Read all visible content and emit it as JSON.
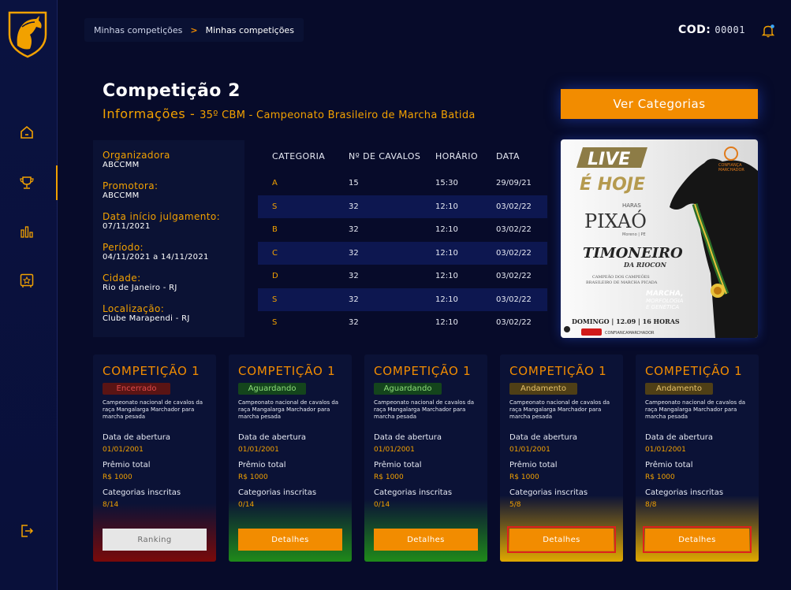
{
  "breadcrumb": {
    "parent": "Minhas competições",
    "separator": ">",
    "current": "Minhas competições"
  },
  "header": {
    "cod_label": "COD:",
    "cod_value": "00001"
  },
  "page": {
    "title": "Competição 2",
    "subtitle_label": "Informações - ",
    "subtitle_detail": "35º CBM - Campeonato Brasileiro de Marcha Batida",
    "categories_button": "Ver Categorias"
  },
  "info": [
    {
      "label": "Organizadora",
      "value": "ABCCMM"
    },
    {
      "label": "Promotora:",
      "value": "ABCCMM"
    },
    {
      "label": "Data início julgamento:",
      "value": " 07/11/2021"
    },
    {
      "label": "Período:",
      "value": "04/11/2021  a  14/11/2021"
    },
    {
      "label": "Cidade:",
      "value": "Rio de Janeiro - RJ"
    },
    {
      "label": "Localização:",
      "value": "Clube Marapendi - RJ"
    }
  ],
  "table": {
    "headers": [
      "CATEGORIA",
      "Nº DE CAVALOS",
      "HORÁRIO",
      "DATA"
    ],
    "rows": [
      [
        "A",
        "15",
        "15:30",
        "29/09/21"
      ],
      [
        "S",
        "32",
        "12:10",
        "03/02/22"
      ],
      [
        "B",
        "32",
        "12:10",
        "03/02/22"
      ],
      [
        "C",
        "32",
        "12:10",
        "03/02/22"
      ],
      [
        "D",
        "32",
        "12:10",
        "03/02/22"
      ],
      [
        "S",
        "32",
        "12:10",
        "03/02/22"
      ],
      [
        "S",
        "32",
        "12:10",
        "03/02/22"
      ]
    ]
  },
  "promo": {
    "live": "LIVE",
    "hoje": "É HOJE",
    "haras": "HARAS",
    "pixao": "PIXAÓ",
    "location": "Moreno | PE",
    "horse_name": "TIMONEIRO",
    "horse_suffix": "DA RIOCON",
    "champion_line1": "CAMPEÃO DOS CAMPEÕES",
    "champion_line2": "BRASILEIRO DE MARCHA PICADA",
    "marcha": "MARCHA,",
    "morfologia": "MORFOLOGIA",
    "genetica": "E GENÉTICA",
    "schedule": "DOMINGO | 12.09 | 16 HORAS",
    "youtube": "CONFIANCAMARCHADOR",
    "brand_line1": "CONFIANÇA",
    "brand_line2": "MARCHADOR"
  },
  "cards": [
    {
      "title": "COMPETIÇÃO 1",
      "status": "Encerrado",
      "desc": "Campeonato nacional de cavalos da raça Mangalarga Marchador para marcha pesada",
      "open_label": "Data de abertura",
      "open_value": "01/01/2001",
      "prize_label": "Prêmio total",
      "prize_value": "R$ 1000",
      "cat_label": "Categorias inscritas",
      "cat_value": "8/14",
      "button": "Ranking"
    },
    {
      "title": "COMPETIÇÃO 1",
      "status": "Aguardando",
      "desc": "Campeonato nacional de cavalos da raça Mangalarga Marchador para marcha pesada",
      "open_label": "Data de abertura",
      "open_value": "01/01/2001",
      "prize_label": "Prêmio total",
      "prize_value": "R$ 1000",
      "cat_label": "Categorias inscritas",
      "cat_value": "0/14",
      "button": "Detalhes"
    },
    {
      "title": "COMPETIÇÃO 1",
      "status": "Aguardando",
      "desc": "Campeonato nacional de cavalos da raça Mangalarga Marchador para marcha pesada",
      "open_label": "Data de abertura",
      "open_value": "01/01/2001",
      "prize_label": "Prêmio total",
      "prize_value": "R$ 1000",
      "cat_label": "Categorias inscritas",
      "cat_value": "0/14",
      "button": "Detalhes"
    },
    {
      "title": "COMPETIÇÃO 1",
      "status": "Andamento",
      "desc": "Campeonato nacional de cavalos da raça Mangalarga Marchador para marcha pesada",
      "open_label": "Data de abertura",
      "open_value": "01/01/2001",
      "prize_label": "Prêmio total",
      "prize_value": "R$ 1000",
      "cat_label": "Categorias inscritas",
      "cat_value": "5/8",
      "button": "Detalhes"
    },
    {
      "title": "COMPETIÇÃO 1",
      "status": "Andamento",
      "desc": "Campeonato nacional de cavalos da raça Mangalarga Marchador para marcha pesada",
      "open_label": "Data de abertura",
      "open_value": "01/01/2001",
      "prize_label": "Prêmio total",
      "prize_value": "R$ 1000",
      "cat_label": "Categorias inscritas",
      "cat_value": "8/8",
      "button": "Detalhes"
    }
  ],
  "colors": {
    "background": "#070b2a",
    "accent": "#f28c00",
    "gold": "#f2a100",
    "closed": "#7a0a0a",
    "waiting": "#1f8a1a",
    "progress": "#e0a800"
  },
  "icons": [
    "horse-logo-icon",
    "home-icon",
    "trophy-icon",
    "chart-icon",
    "star-safe-icon",
    "logout-icon",
    "bell-icon"
  ]
}
